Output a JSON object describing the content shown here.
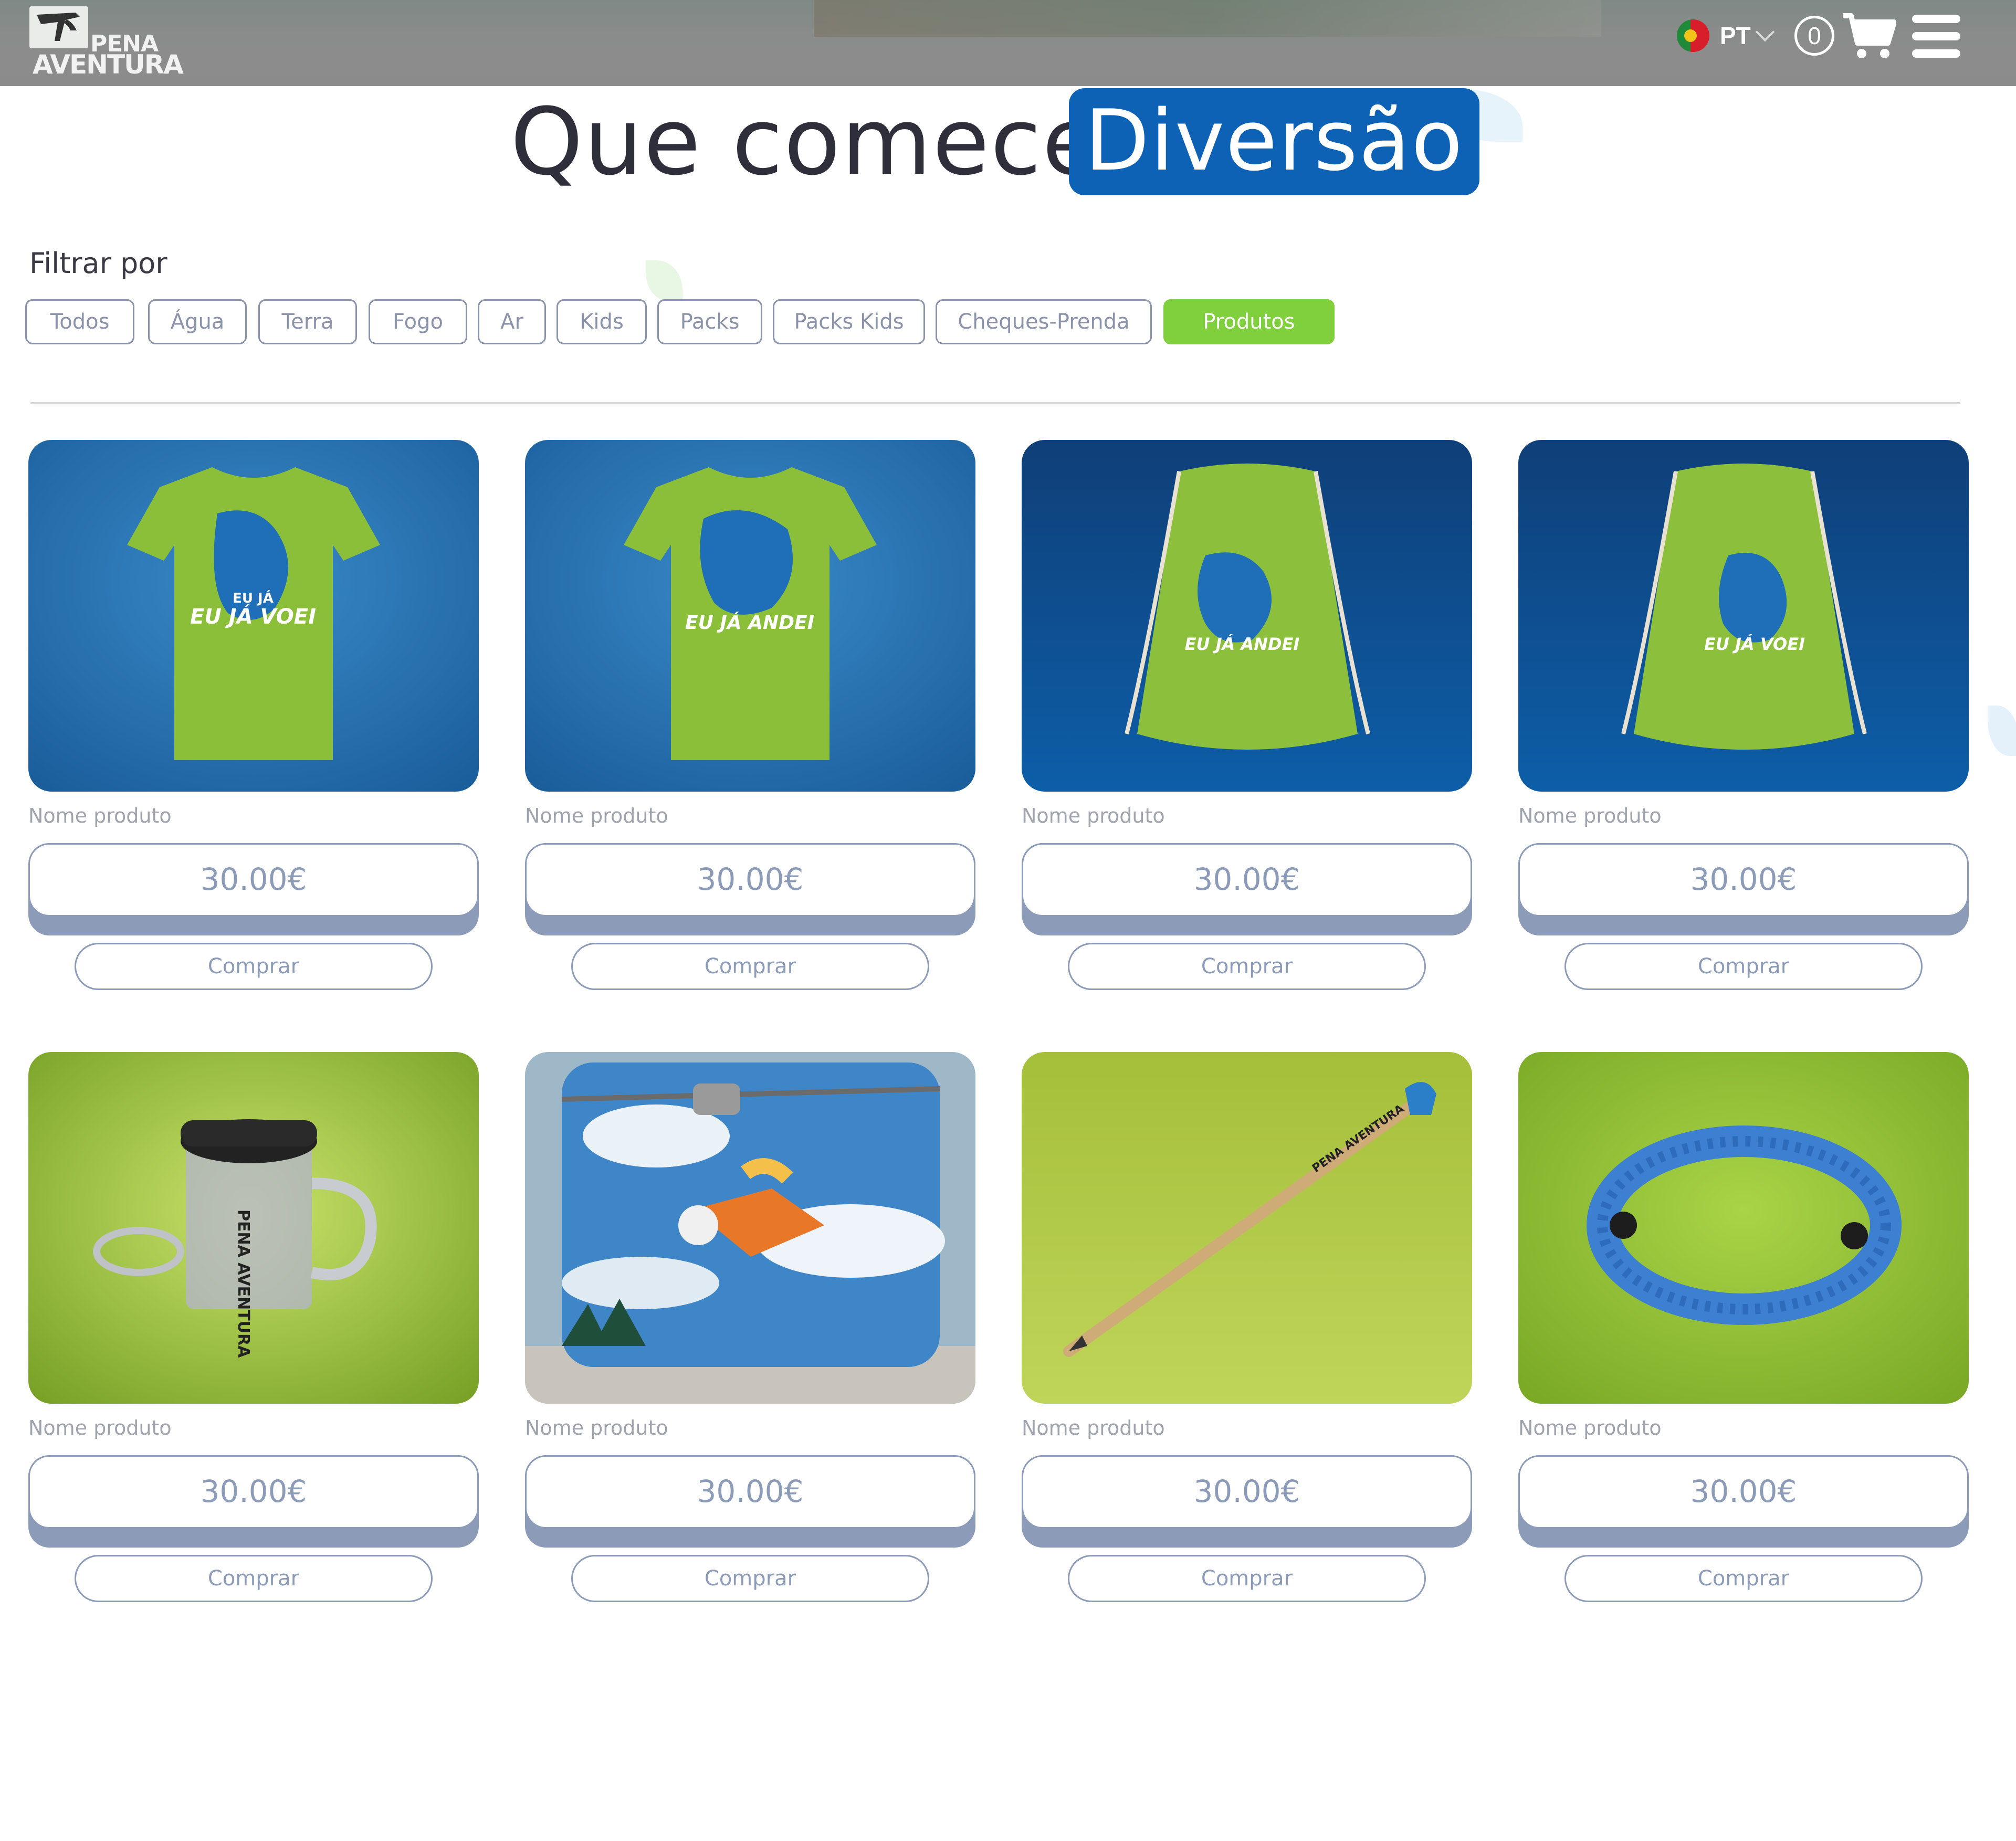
{
  "header": {
    "logo_line1": "PENA",
    "logo_line2": "AVENTURA",
    "language": "PT",
    "cart_count": "0"
  },
  "hero": {
    "title": "Que comece a",
    "highlight": "Diversão"
  },
  "filters": {
    "label": "Filtrar por",
    "items": [
      "Todos",
      "Água",
      "Terra",
      "Fogo",
      "Ar",
      "Kids",
      "Packs",
      "Packs Kids",
      "Cheques-Prenda",
      "Produtos"
    ],
    "active": "Produtos"
  },
  "products": [
    {
      "name": "Nome produto",
      "price": "30.00€",
      "buy": "Comprar",
      "image_text": "EU JÁ VOEI"
    },
    {
      "name": "Nome produto",
      "price": "30.00€",
      "buy": "Comprar",
      "image_text": "EU JÁ ANDEI"
    },
    {
      "name": "Nome produto",
      "price": "30.00€",
      "buy": "Comprar",
      "image_text": "EU JÁ ANDEI"
    },
    {
      "name": "Nome produto",
      "price": "30.00€",
      "buy": "Comprar",
      "image_text": "EU JÁ VOEI"
    },
    {
      "name": "Nome produto",
      "price": "30.00€",
      "buy": "Comprar",
      "image_text": "PENA AVENTURA"
    },
    {
      "name": "Nome produto",
      "price": "30.00€",
      "buy": "Comprar",
      "image_text": ""
    },
    {
      "name": "Nome produto",
      "price": "30.00€",
      "buy": "Comprar",
      "image_text": "PENA AVENTURA"
    },
    {
      "name": "Nome produto",
      "price": "30.00€",
      "buy": "Comprar",
      "image_text": ""
    }
  ],
  "colors": {
    "brand_blue": "#0d62b6",
    "active_green": "#7fd03c",
    "outline": "#8c9bb8"
  }
}
